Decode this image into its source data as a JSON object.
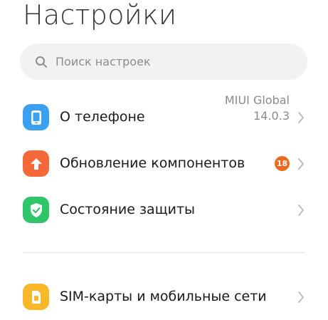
{
  "header": {
    "title": "Настройки"
  },
  "search": {
    "icon": "search-icon",
    "placeholder": "Поиск настроек"
  },
  "items": [
    {
      "label": "О телефоне",
      "icon": "phone-icon",
      "icon_color": "#3aa0f2",
      "value_line1": "MIUI Global",
      "value_line2": "14.0.3"
    },
    {
      "label": "Обновление компонентов",
      "icon": "arrow-up-icon",
      "icon_color": "#f4683a",
      "badge": "18",
      "badge_color": "#ec6a1e"
    },
    {
      "label": "Состояние защиты",
      "icon": "shield-check-icon",
      "icon_color": "#2fc66a"
    },
    {
      "label": "SIM-карты и мобильные сети",
      "icon": "sim-card-icon",
      "icon_color": "#f8b82a"
    }
  ]
}
